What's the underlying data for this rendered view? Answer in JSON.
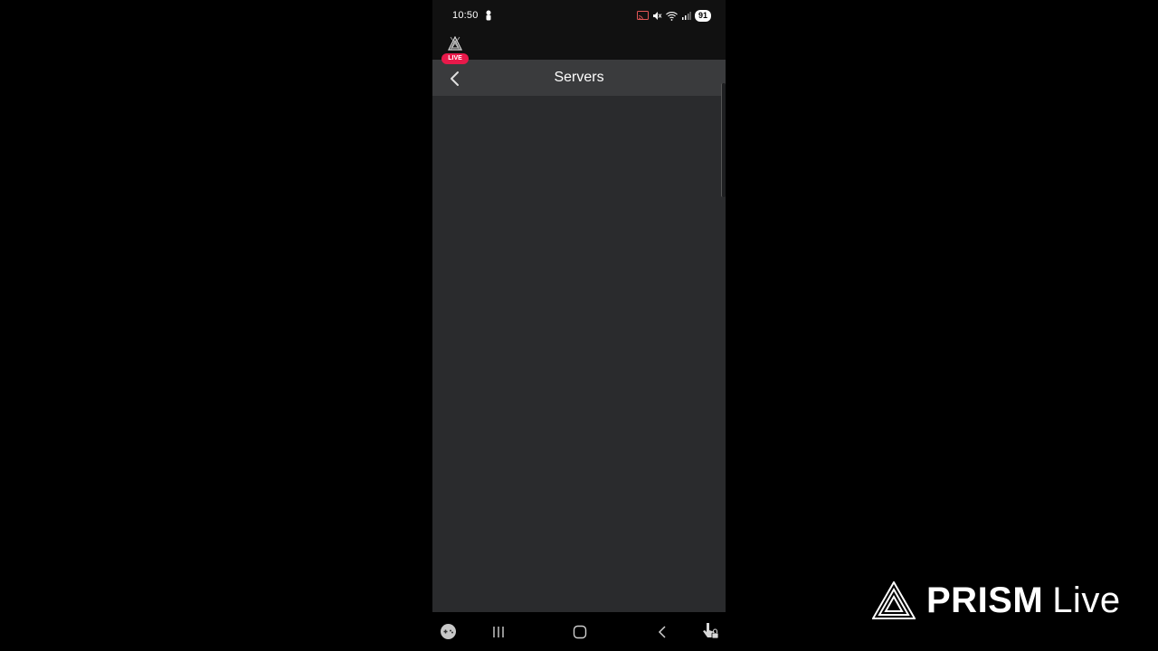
{
  "status_bar": {
    "time": "10:50",
    "battery": "91",
    "icons": [
      "person-icon",
      "cast-icon",
      "mute-icon",
      "wifi-icon",
      "signal-icon",
      "battery-icon"
    ]
  },
  "overlay": {
    "live_badge": "LIVE"
  },
  "header": {
    "title": "Servers",
    "back_icon": "chevron-left-icon"
  },
  "nav_bar": {
    "icons": [
      "game-launcher-icon",
      "recent-apps-icon",
      "home-icon",
      "back-icon",
      "touch-lock-icon"
    ]
  },
  "watermark": {
    "brand": "PRISM",
    "suffix": "Live",
    "logo_icon": "prism-triangle-icon"
  },
  "colors": {
    "header_bg": "#3a3b3d",
    "content_bg": "#2a2b2d",
    "live_badge": "#e8194a"
  }
}
